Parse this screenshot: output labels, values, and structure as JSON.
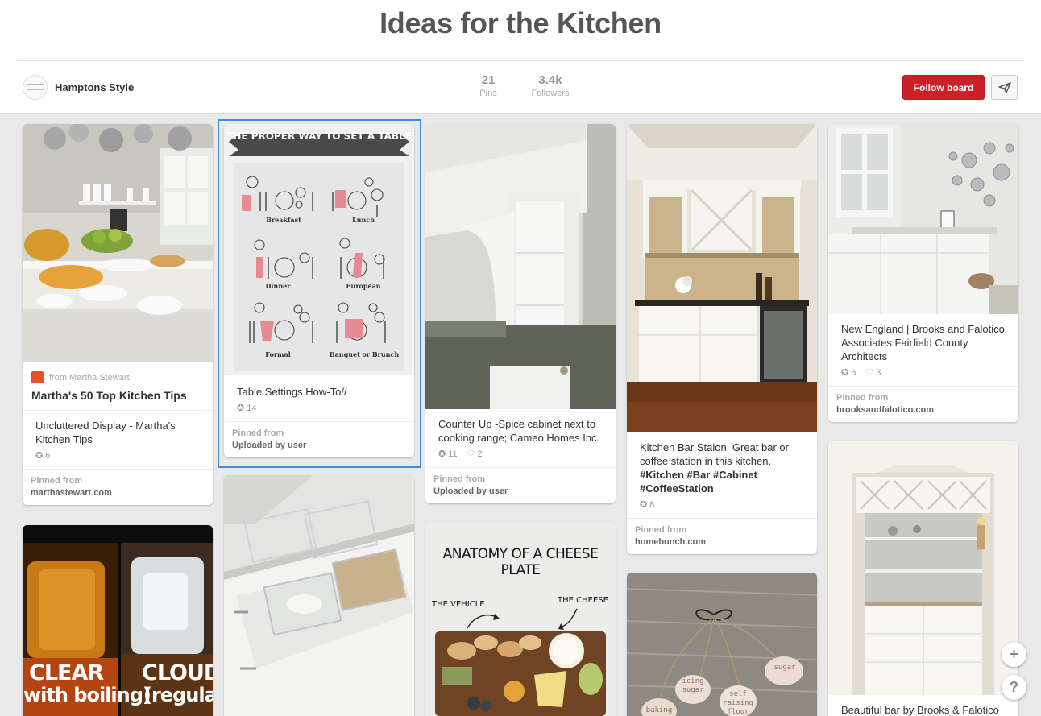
{
  "board": {
    "title": "Ideas for the Kitchen",
    "owner": "Hamptons Style",
    "pins_count": "21",
    "pins_label": "Pins",
    "followers_count": "3.4k",
    "followers_label": "Followers",
    "follow_label": "Follow board"
  },
  "pins": [
    {
      "rich_source": "from Martha Stewart",
      "rich_title": "Martha's 50 Top Kitchen Tips",
      "description": "Uncluttered Display - Martha's Kitchen Tips",
      "repins": "6",
      "pinned_from_label": "Pinned from",
      "domain": "marthastewart.com"
    },
    {
      "image_title": "THE PROPER WAY TO SET A TABLE",
      "settings": [
        "Breakfast",
        "Lunch",
        "Dinner",
        "European",
        "Formal",
        "Banquet or Brunch"
      ],
      "description": "Table Settings How-To//",
      "repins": "14",
      "pinned_from_label": "Pinned from",
      "domain": "Uploaded by user"
    },
    {
      "description": "Counter Up -Spice cabinet next to cooking range; Cameo Homes Inc.",
      "repins": "11",
      "likes": "2",
      "pinned_from_label": "Pinned from",
      "domain": "Uploaded by user"
    },
    {
      "description_plain": "Kitchen Bar Staion. Great bar or coffee station in this kitchen.",
      "description_tags": "#Kitchen #Bar #Cabinet #CoffeeStation",
      "repins": "8",
      "pinned_from_label": "Pinned from",
      "domain": "homebunch.com"
    },
    {
      "description": "New England | Brooks and Falotico Associates Fairfield County Architects",
      "repins": "6",
      "likes": "3",
      "pinned_from_label": "Pinned from",
      "domain": "brooksandfalotico.com"
    },
    {
      "image_text_left": "CLEAR",
      "image_sub_left": "with boiling)",
      "image_text_right": "CLOUDY",
      "image_sub_right": "(regular)"
    },
    {},
    {
      "image_title": "ANATOMY OF A CHEESE PLATE",
      "label_vehicle": "THE VEHICLE",
      "label_cheese": "THE CHEESE"
    },
    {
      "tags": [
        "icing sugar",
        "self raising flour",
        "sugar",
        "baking"
      ]
    },
    {
      "description": "Beautiful bar by Brooks & Falotico"
    }
  ],
  "colors": {
    "accent_red": "#cb2027",
    "selection_blue": "#3a8fd6",
    "grid_background": "#e9e9e9"
  },
  "icons": {
    "send": "paper-plane-icon",
    "add": "plus-icon",
    "help": "question-icon"
  },
  "floating": {
    "add_symbol": "+",
    "help_symbol": "?"
  }
}
